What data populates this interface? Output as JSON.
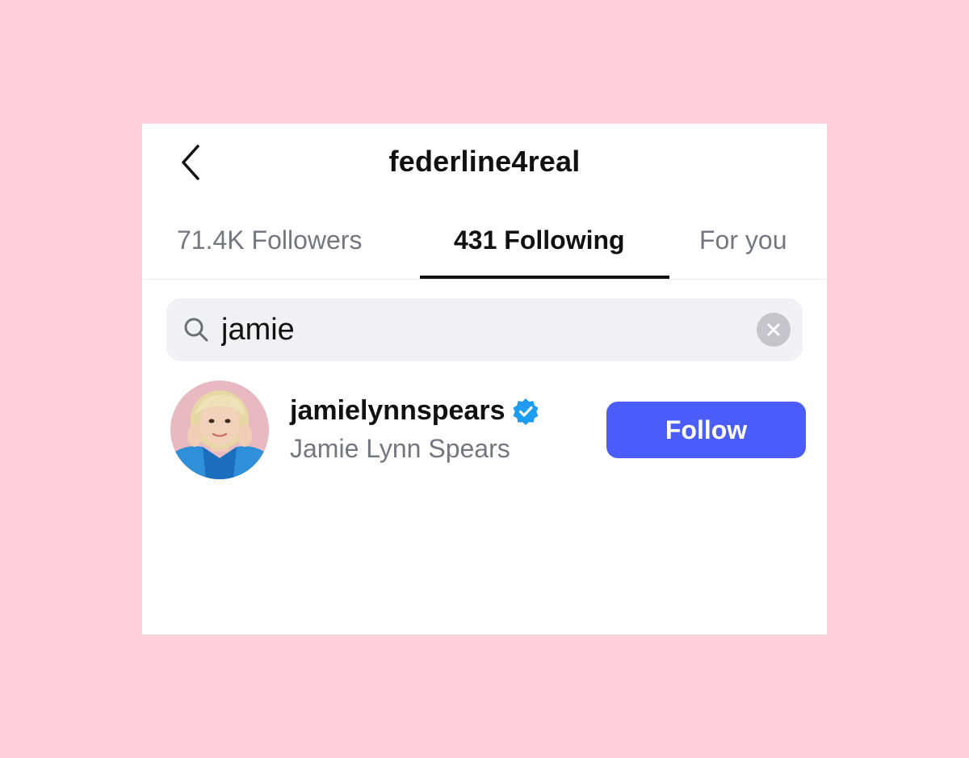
{
  "header": {
    "title": "federline4real",
    "back_icon": "chevron-left-icon"
  },
  "tabs": [
    {
      "label": "71.4K Followers",
      "active": false
    },
    {
      "label": "431 Following",
      "active": true
    },
    {
      "label": "For you",
      "active": false
    }
  ],
  "search": {
    "value": "jamie",
    "icon": "search-icon",
    "clear_icon": "clear-icon"
  },
  "results": [
    {
      "username": "jamielynnspears",
      "full_name": "Jamie Lynn Spears",
      "verified": true,
      "follow_label": "Follow"
    }
  ],
  "colors": {
    "background": "#ffd1dc",
    "panel": "#ffffff",
    "accent": "#4a5dfa",
    "verified_badge": "#1d9bf0",
    "muted_text": "#737780",
    "search_bg": "#f0f1f4"
  }
}
